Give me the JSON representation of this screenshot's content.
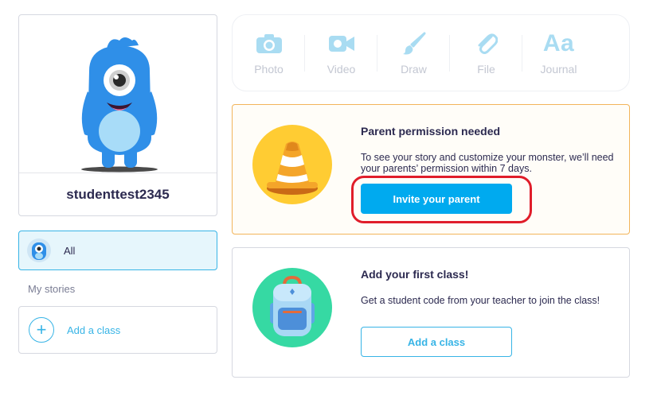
{
  "profile": {
    "username": "studenttest2345",
    "monster_color": "#2f8fe8"
  },
  "sidebar": {
    "all_label": "All",
    "section_label": "My stories",
    "add_class_label": "Add a class"
  },
  "toolbar": {
    "tools": [
      {
        "label": "Photo",
        "icon": "camera-icon"
      },
      {
        "label": "Video",
        "icon": "video-camera-icon"
      },
      {
        "label": "Draw",
        "icon": "paintbrush-icon"
      },
      {
        "label": "File",
        "icon": "paperclip-icon"
      },
      {
        "label": "Journal",
        "icon": "Aa"
      }
    ],
    "icon_color": "#a9dcf2"
  },
  "permission_card": {
    "title": "Parent permission needed",
    "text": "To see your story and customize your monster, we’ll need your parents’ permission within 7 days.",
    "button_label": "Invite your parent",
    "accent": "#ffcc33",
    "border_color": "#f2b45a",
    "highlight_color": "#e01d2a"
  },
  "class_card": {
    "title": "Add your first class!",
    "text": "Get a student code from your teacher to join the class!",
    "button_label": "Add a class",
    "accent": "#36d9a3"
  },
  "colors": {
    "primary": "#00aaef",
    "text": "#2c2a50"
  }
}
